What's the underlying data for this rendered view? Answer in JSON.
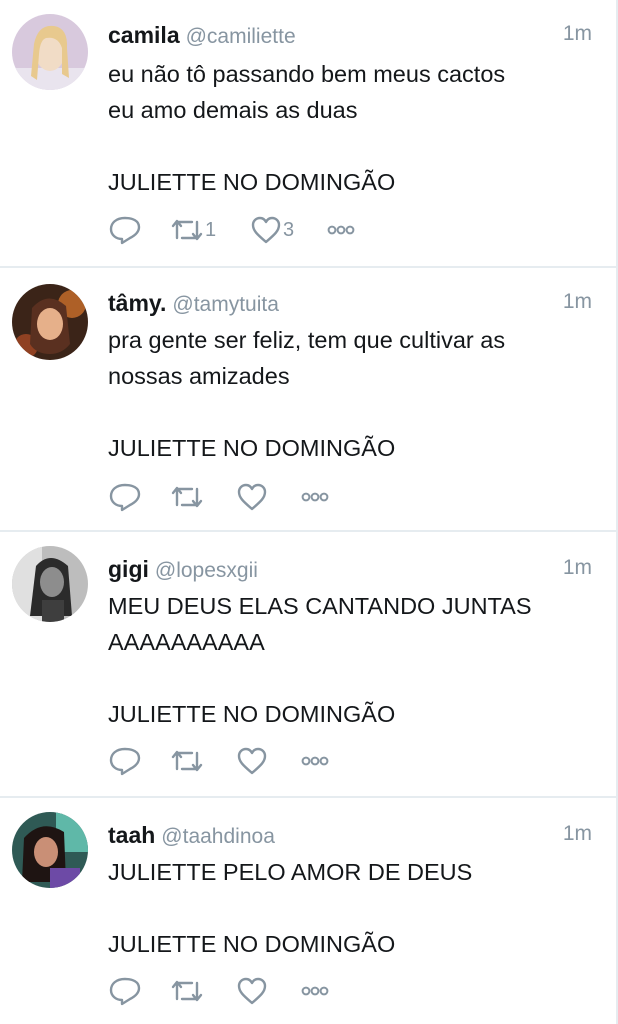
{
  "tweets": [
    {
      "name": "camila",
      "handle": "@camiliette",
      "time": "1m",
      "lines": [
        "eu não tô passando bem meus cactos",
        "eu amo demais as duas",
        "",
        "JULIETTE NO DOMINGÃO"
      ],
      "retweets": "1",
      "likes": "3"
    },
    {
      "name": "tâmy.",
      "handle": "@tamytuita",
      "time": "1m",
      "lines": [
        "pra gente ser feliz, tem que cultivar as",
        "nossas amizades",
        "",
        "JULIETTE NO DOMINGÃO"
      ],
      "retweets": "",
      "likes": ""
    },
    {
      "name": "gigi",
      "handle": "@lopesxgii",
      "time": "1m",
      "lines": [
        "MEU DEUS ELAS CANTANDO JUNTAS",
        "AAAAAAAAAA",
        "",
        "JULIETTE NO DOMINGÃO"
      ],
      "retweets": "",
      "likes": ""
    },
    {
      "name": "taah",
      "handle": "@taahdinoa",
      "time": "1m",
      "lines": [
        "JULIETTE PELO AMOR DE DEUS",
        "",
        "JULIETTE NO DOMINGÃO"
      ],
      "retweets": "",
      "likes": ""
    }
  ],
  "icons": {
    "reply": "reply-icon",
    "retweet": "retweet-icon",
    "like": "heart-icon",
    "more": "more-icon"
  },
  "colors": {
    "icon": "#8795a1",
    "divider": "#e6ecf0"
  }
}
